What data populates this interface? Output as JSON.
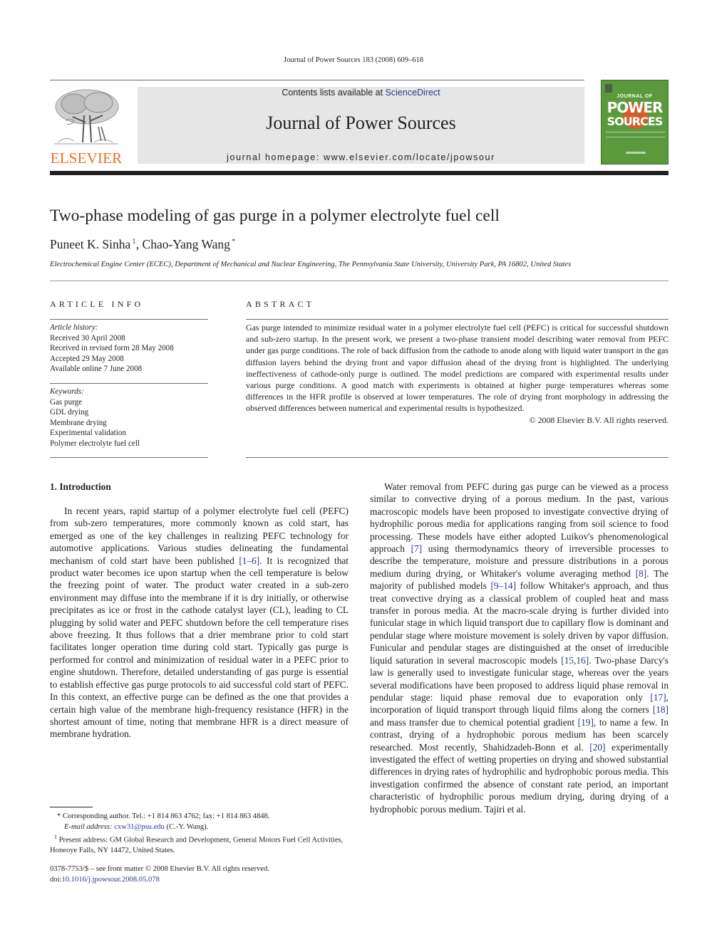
{
  "header": {
    "running_head": "Journal of Power Sources 183 (2008) 609–618",
    "contents_prefix": "Contents lists available at ",
    "contents_link": "ScienceDirect",
    "journal_title": "Journal of Power Sources",
    "homepage": "journal homepage: www.elsevier.com/locate/jpowsour",
    "publisher_logo_text": "ELSEVIER",
    "cover": {
      "line1": "JOURNAL OF",
      "line2": "POWER",
      "line3": "SOURCES",
      "bg_color": "#5a9a3c",
      "accent_color": "#e0562a"
    },
    "colors": {
      "elsevier_orange": "#e9711c",
      "link_blue": "#2a3a8a"
    }
  },
  "article": {
    "title": "Two-phase modeling of gas purge in a polymer electrolyte fuel cell",
    "authors": [
      {
        "name": "Puneet K. Sinha",
        "mark": "1"
      },
      {
        "name": "Chao-Yang Wang",
        "mark": "*"
      }
    ],
    "author_separator": ", ",
    "affiliation": "Electrochemical Engine Center (ECEC), Department of Mechanical and Nuclear Engineering, The Pennsylvania State University, University Park, PA 16802, United States"
  },
  "article_info": {
    "heading": "ARTICLE INFO",
    "history_label": "Article history:",
    "history": [
      "Received 30 April 2008",
      "Received in revised form 28 May 2008",
      "Accepted 29 May 2008",
      "Available online 7 June 2008"
    ],
    "keywords_label": "Keywords:",
    "keywords": [
      "Gas purge",
      "GDL drying",
      "Membrane drying",
      "Experimental validation",
      "Polymer electrolyte fuel cell"
    ]
  },
  "abstract": {
    "heading": "ABSTRACT",
    "text": "Gas purge intended to minimize residual water in a polymer electrolyte fuel cell (PEFC) is critical for successful shutdown and sub-zero startup. In the present work, we present a two-phase transient model describing water removal from PEFC under gas purge conditions. The role of back diffusion from the cathode to anode along with liquid water transport in the gas diffusion layers behind the drying front and vapor diffusion ahead of the drying front is highlighted. The underlying ineffectiveness of cathode-only purge is outlined. The model predictions are compared with experimental results under various purge conditions. A good match with experiments is obtained at higher purge temperatures whereas some differences in the HFR profile is observed at lower temperatures. The role of drying front morphology in addressing the observed differences between numerical and experimental results is hypothesized.",
    "copyright": "© 2008 Elsevier B.V. All rights reserved."
  },
  "body": {
    "section_heading": "1.  Introduction",
    "left_para": [
      {
        "t": "In recent years, rapid startup of a polymer electrolyte fuel cell (PEFC) from sub-zero temperatures, more commonly known as cold start, has emerged as one of the key challenges in realizing PEFC technology for automotive applications. Various studies delineating the fundamental mechanism of cold start have been published "
      },
      {
        "ref": "[1–6]"
      },
      {
        "t": ". It is recognized that product water becomes ice upon startup when the cell temperature is below the freezing point of water. The product water created in a sub-zero environment may diffuse into the membrane if it is dry initially, or otherwise precipitates as ice or frost in the cathode catalyst layer (CL), leading to CL plugging by solid water and PEFC shutdown before the cell temperature rises above freezing. It thus follows that a drier membrane prior to cold start facilitates longer operation time during cold start. Typically gas purge is performed for control and minimization of residual water in a PEFC prior to engine shutdown. Therefore, detailed understanding of gas purge is essential to establish effective gas purge protocols to aid successful cold start of PEFC. In this context, an effective purge can be defined as the one that provides a certain high value of the membrane high-frequency resistance (HFR) in the shortest amount of time, noting that membrane HFR is a direct measure of membrane hydration."
      }
    ],
    "right_para": [
      {
        "t": "Water removal from PEFC during gas purge can be viewed as a process similar to convective drying of a porous medium. In the past, various macroscopic models have been proposed to investigate convective drying of hydrophilic porous media for applications ranging from soil science to food processing. These models have either adopted Luikov's phenomenological approach "
      },
      {
        "ref": "[7]"
      },
      {
        "t": " using thermodynamics theory of irreversible processes to describe the temperature, moisture and pressure distributions in a porous medium during drying, or Whitaker's volume averaging method "
      },
      {
        "ref": "[8]"
      },
      {
        "t": ". The majority of published models "
      },
      {
        "ref": "[9–14]"
      },
      {
        "t": " follow Whitaker's approach, and thus treat convective drying as a classical problem of coupled heat and mass transfer in porous media. At the macro-scale drying is further divided into funicular stage in which liquid transport due to capillary flow is dominant and pendular stage where moisture movement is solely driven by vapor diffusion. Funicular and pendular stages are distinguished at the onset of irreducible liquid saturation in several macroscopic models "
      },
      {
        "ref": "[15,16]"
      },
      {
        "t": ". Two-phase Darcy's law is generally used to investigate funicular stage, whereas over the years several modifications have been proposed to address liquid phase removal in pendular stage: liquid phase removal due to evaporation only "
      },
      {
        "ref": "[17]"
      },
      {
        "t": ", incorporation of liquid transport through liquid films along the corners "
      },
      {
        "ref": "[18]"
      },
      {
        "t": " and mass transfer due to chemical potential gradient "
      },
      {
        "ref": "[19]"
      },
      {
        "t": ", to name a few. In contrast, drying of a hydrophobic porous medium has been scarcely researched. Most recently, Shahidzadeh-Bonn et al. "
      },
      {
        "ref": "[20]"
      },
      {
        "t": " experimentally investigated the effect of wetting properties on drying and showed substantial differences in drying rates of hydrophilic and hydrophobic porous media. This investigation confirmed the absence of constant rate period, an important characteristic of hydrophilic porous medium drying, during drying of a hydrophobic porous medium. Tajiri et al."
      }
    ]
  },
  "footnotes": {
    "corresponding": "* Corresponding author. Tel.: +1 814 863 4762; fax: +1 814 863 4848.",
    "email_label": "E-mail address: ",
    "email": "cxw31@psu.edu",
    "email_suffix": " (C.-Y. Wang).",
    "present_address_mark": "1",
    "present_address": " Present address: GM Global Research and Development, General Motors Fuel Cell Activities, Honeoye Falls, NY 14472, United States."
  },
  "issn": {
    "line1": "0378-7753/$ – see front matter © 2008 Elsevier B.V. All rights reserved.",
    "doi_prefix": "doi:",
    "doi": "10.1016/j.jpowsour.2008.05.078"
  }
}
